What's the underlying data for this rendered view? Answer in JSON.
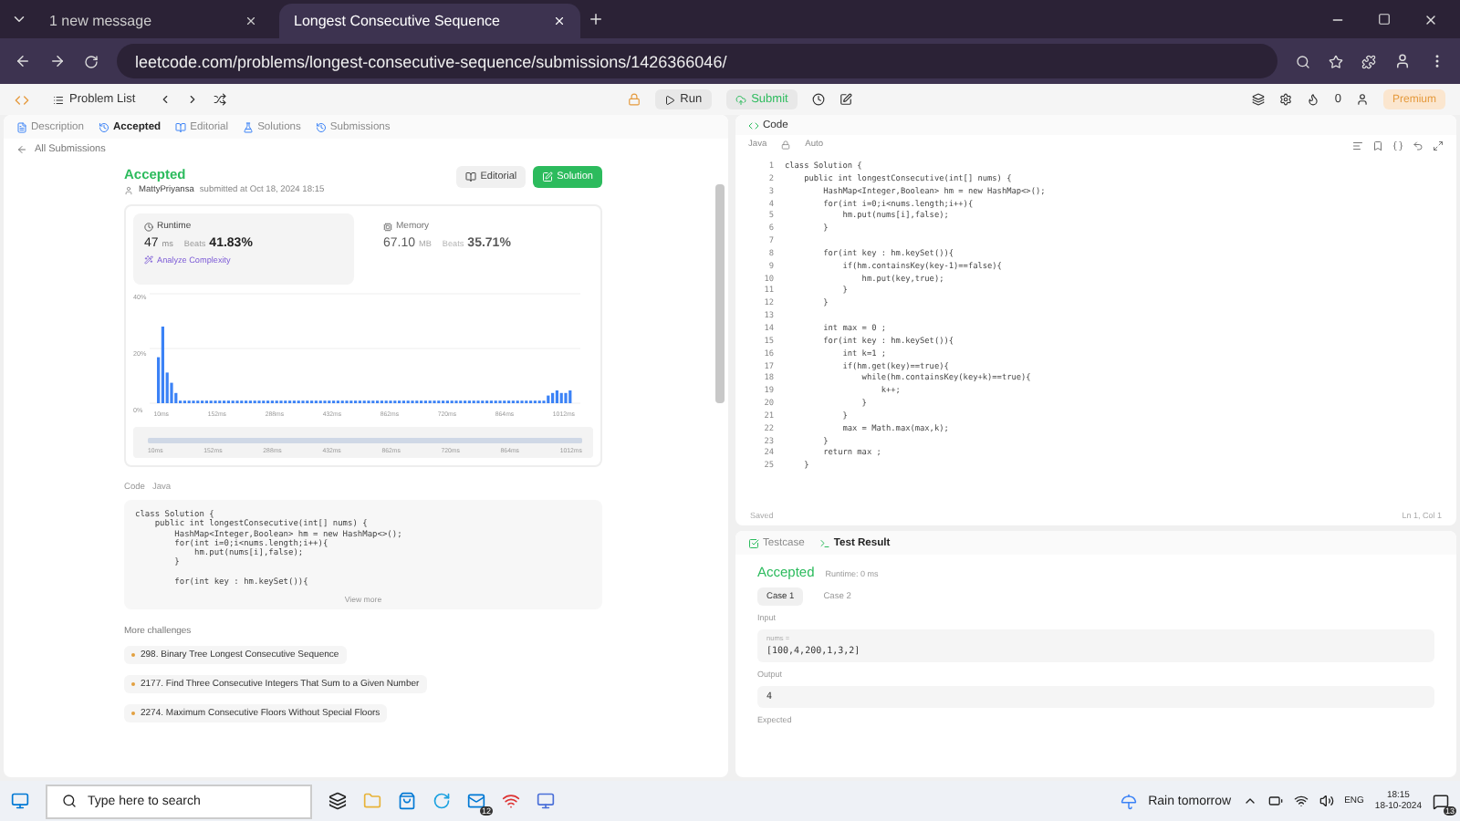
{
  "browser": {
    "tabs": [
      {
        "title": "1 new message",
        "selected": false
      },
      {
        "title": "Longest Consecutive Sequence",
        "selected": true
      }
    ],
    "url": "leetcode.com/problems/longest-consecutive-sequence/submissions/1426366046/"
  },
  "toolbar": {
    "problem_list": "Problem List",
    "run": "Run",
    "submit": "Submit",
    "streak": "0",
    "premium": "Premium"
  },
  "left_tabs": [
    {
      "label": "Description",
      "selected": false
    },
    {
      "label": "Accepted",
      "selected": true
    },
    {
      "label": "Editorial",
      "selected": false
    },
    {
      "label": "Solutions",
      "selected": false
    },
    {
      "label": "Submissions",
      "selected": false
    }
  ],
  "back_link": "All Submissions",
  "submission": {
    "status": "Accepted",
    "user": "MattyPriyansa",
    "submitted": "submitted at Oct 18, 2024 18:15",
    "editorial": "Editorial",
    "solution": "Solution"
  },
  "stats": [
    {
      "label": "Runtime",
      "value": "47",
      "unit": "ms",
      "beats_label": "Beats",
      "beats": "41.83%",
      "selected": true
    },
    {
      "label": "Memory",
      "value": "67.10",
      "unit": "MB",
      "beats_label": "Beats",
      "beats": "35.71%",
      "selected": false
    }
  ],
  "analyze": "Analyze Complexity",
  "histogram": {
    "y_ticks": [
      "40%",
      "20%",
      "0%"
    ],
    "x_labels": [
      "10ms",
      "152ms",
      "288ms",
      "432ms",
      "862ms",
      "720ms",
      "864ms",
      "1012ms"
    ]
  },
  "range_slider": {
    "level": 1,
    "labels": [
      "10ms",
      "152ms",
      "288ms",
      "432ms",
      "862ms",
      "720ms",
      "864ms",
      "1012ms"
    ]
  },
  "submitted_code": {
    "label": "Code",
    "language": "Java",
    "blocks": [
      [
        "class Solution {",
        "    public int longestConsecutive(int[] nums) {",
        "        HashMap<Integer,Boolean> hm = new HashMap<>();",
        "        for(int i=0;i<nums.length;i++){",
        "            hm.put(nums[i],false);",
        "        }"
      ],
      [
        "        for(int key : hm.keySet()){"
      ]
    ],
    "view_more": "View more"
  },
  "more_challenges": {
    "title": "More challenges",
    "items": [
      "298. Binary Tree Longest Consecutive Sequence",
      "2177. Find Three Consecutive Integers That Sum to a Given Number",
      "2274. Maximum Consecutive Floors Without Special Floors"
    ]
  },
  "editor": {
    "title": "Code",
    "language": "Java",
    "mode": "Auto",
    "lines": [
      {
        "number": "1",
        "text": "class Solution {"
      },
      {
        "number": "2",
        "text": "    public int longestConsecutive(int[] nums) {"
      },
      {
        "number": "3",
        "text": "        HashMap<Integer,Boolean> hm = new HashMap<>();"
      },
      {
        "number": "4",
        "text": "        for(int i=0;i<nums.length;i++){"
      },
      {
        "number": "5",
        "text": "            hm.put(nums[i],false);"
      },
      {
        "number": "6",
        "text": "        }"
      },
      {
        "number": "7"
      },
      {
        "number": "8",
        "text": "        for(int key : hm.keySet()){"
      },
      {
        "number": "9",
        "text": "            if(hm.containsKey(key-1)==false){"
      },
      {
        "number": "10",
        "text": "                hm.put(key,true);"
      },
      {
        "number": "11",
        "text": "            }"
      },
      {
        "number": "12",
        "text": "        }"
      },
      {
        "number": "13"
      },
      {
        "number": "14",
        "text": "        int max = 0 ;"
      },
      {
        "number": "15",
        "text": "        for(int key : hm.keySet()){"
      },
      {
        "number": "16",
        "text": "            int k=1 ;"
      },
      {
        "number": "17",
        "text": "            if(hm.get(key)==true){"
      },
      {
        "number": "18",
        "text": "                while(hm.containsKey(key+k)==true){"
      },
      {
        "number": "19",
        "text": "                    k++;"
      },
      {
        "number": "20",
        "text": "                }"
      },
      {
        "number": "21",
        "text": "            }"
      },
      {
        "number": "22",
        "text": "            max = Math.max(max,k);"
      },
      {
        "number": "23",
        "text": "        }"
      },
      {
        "number": "24",
        "text": "        return max ;"
      },
      {
        "number": "25",
        "text": "    }"
      }
    ],
    "status": "Saved",
    "cursor": "Ln 1, Col 1"
  },
  "test_panel": {
    "tabs": [
      {
        "label": "Testcase",
        "selected": false
      },
      {
        "label": "Test Result",
        "selected": true
      }
    ],
    "result": "Accepted",
    "runtime": "Runtime: 0 ms",
    "cases": [
      {
        "label": "Case 1",
        "selected": true
      },
      {
        "label": "Case 2",
        "selected": false
      }
    ],
    "input_label": "Input",
    "variable": "nums =",
    "input_value": "[100,4,200,1,3,2]",
    "output_label": "Output",
    "output_value": "4",
    "expected_label": "Expected"
  },
  "taskbar": {
    "search": "Type here to search",
    "mail_badge": "12",
    "weather": "Rain tomorrow",
    "language": "ENG",
    "time": "18:15",
    "date": "18-10-2024",
    "notifications": "13"
  }
}
